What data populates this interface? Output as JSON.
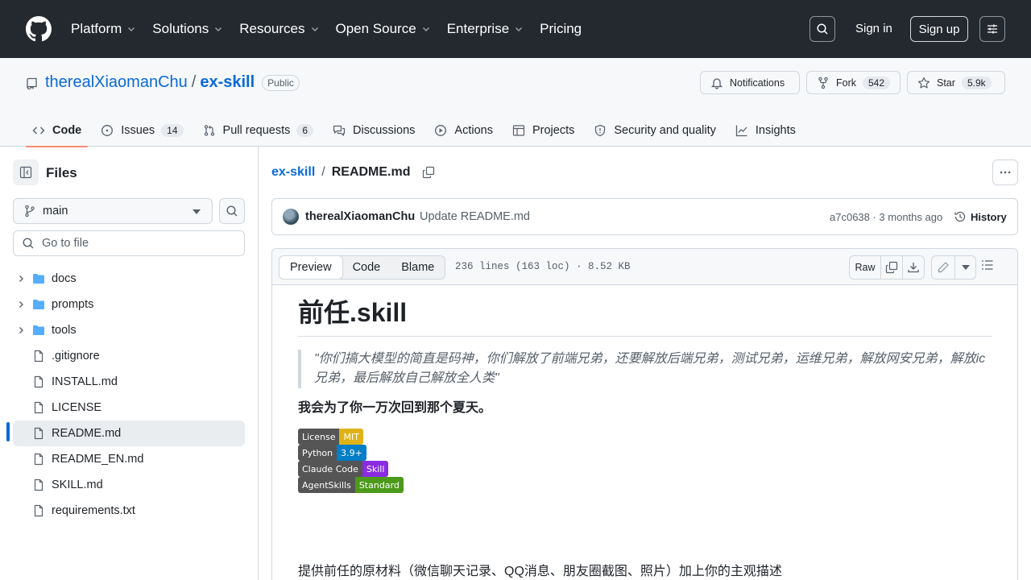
{
  "topnav": {
    "items": [
      "Platform",
      "Solutions",
      "Resources",
      "Open Source",
      "Enterprise",
      "Pricing"
    ],
    "sign_in": "Sign in",
    "sign_up": "Sign up"
  },
  "repo": {
    "owner": "therealXiaomanChu",
    "separator": "/",
    "name": "ex-skill",
    "visibility": "Public",
    "notifications_label": "Notifications",
    "fork_label": "Fork",
    "fork_count": "542",
    "star_label": "Star",
    "star_count": "5.9k"
  },
  "tabs": [
    {
      "label": "Code",
      "icon": "code-icon"
    },
    {
      "label": "Issues",
      "count": "14",
      "icon": "issue-icon"
    },
    {
      "label": "Pull requests",
      "count": "6",
      "icon": "pull-request-icon"
    },
    {
      "label": "Discussions",
      "icon": "discussions-icon"
    },
    {
      "label": "Actions",
      "icon": "play-icon"
    },
    {
      "label": "Projects",
      "icon": "table-icon"
    },
    {
      "label": "Security and quality",
      "icon": "shield-icon"
    },
    {
      "label": "Insights",
      "icon": "graph-icon"
    }
  ],
  "sidebar": {
    "title": "Files",
    "branch": "main",
    "goto_placeholder": "Go to file",
    "tree": [
      {
        "name": "docs",
        "type": "folder"
      },
      {
        "name": "prompts",
        "type": "folder"
      },
      {
        "name": "tools",
        "type": "folder"
      },
      {
        "name": ".gitignore",
        "type": "file"
      },
      {
        "name": "INSTALL.md",
        "type": "file"
      },
      {
        "name": "LICENSE",
        "type": "file"
      },
      {
        "name": "README.md",
        "type": "file",
        "selected": true
      },
      {
        "name": "README_EN.md",
        "type": "file"
      },
      {
        "name": "SKILL.md",
        "type": "file"
      },
      {
        "name": "requirements.txt",
        "type": "file"
      }
    ]
  },
  "breadcrumb": {
    "repo": "ex-skill",
    "separator": "/",
    "file": "README.md"
  },
  "commit": {
    "author": "therealXiaomanChu",
    "message": "Update README.md",
    "meta": "a7c0638 · 3 months ago",
    "history_label": "History"
  },
  "file": {
    "tabs": [
      "Preview",
      "Code",
      "Blame"
    ],
    "info": "236 lines (163 loc) · 8.52 KB",
    "raw_label": "Raw"
  },
  "readme": {
    "title": "前任.skill",
    "quote": "\"你们搞大模型的简直是码神，你们解放了前端兄弟，还要解放后端兄弟，测试兄弟，运维兄弟，解放网安兄弟，解放ic兄弟，最后解放自己解放全人类\"",
    "bold_line": "我会为了你一万次回到那个夏天。",
    "badges": [
      {
        "label": "License",
        "value": "MIT",
        "color": "#dfb317"
      },
      {
        "label": "Python",
        "value": "3.9+",
        "color": "#007ec6"
      },
      {
        "label": "Claude Code",
        "value": "Skill",
        "color": "#8a2be2"
      },
      {
        "label": "AgentSkills",
        "value": "Standard",
        "color": "#4c9a1b"
      }
    ],
    "paragraph": "提供前任的原材料（微信聊天记录、QQ消息、朋友圈截图、照片）加上你的主观描述"
  },
  "colors": {
    "header_bg": "#24292f",
    "link": "#0969da",
    "active_tab_underline": "#fd8c73",
    "folder": "#54aeff"
  }
}
